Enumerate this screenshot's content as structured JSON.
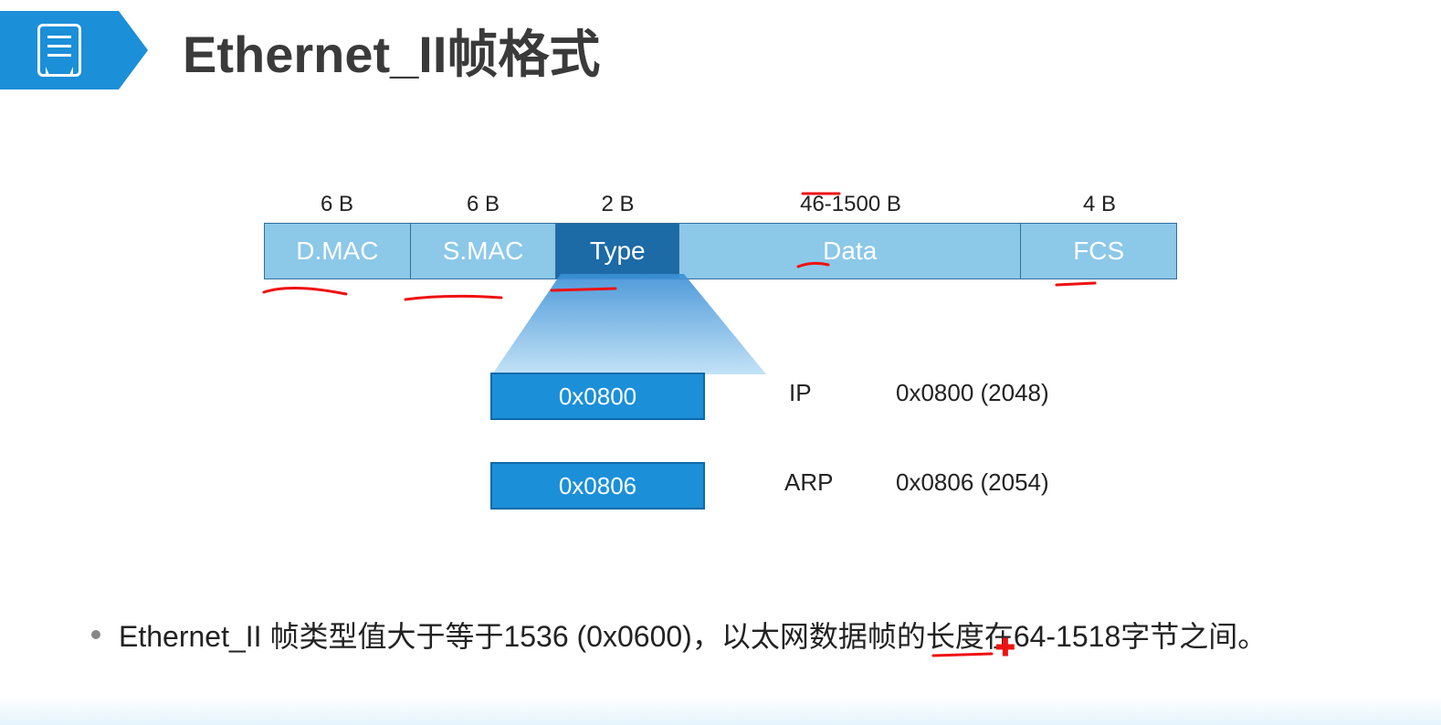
{
  "header": {
    "title": "Ethernet_II帧格式"
  },
  "frame": {
    "fields": [
      {
        "size": "6 B",
        "label": "D.MAC",
        "wclass": "w-dmac",
        "shade": "light"
      },
      {
        "size": "6 B",
        "label": "S.MAC",
        "wclass": "w-smac",
        "shade": "light"
      },
      {
        "size": "2 B",
        "label": "Type",
        "wclass": "w-type",
        "shade": "dark"
      },
      {
        "size": "46-1500 B",
        "label": "Data",
        "wclass": "w-data",
        "shade": "light"
      },
      {
        "size": "4 B",
        "label": "FCS",
        "wclass": "w-fcs",
        "shade": "light"
      }
    ]
  },
  "type_values": {
    "box1": "0x0800",
    "box2": "0x0806",
    "row1_proto": "IP",
    "row1_val": "0x0800 (2048)",
    "row2_proto": "ARP",
    "row2_val": "0x0806 (2054)"
  },
  "bullet": {
    "text": "Ethernet_II 帧类型值大于等于1536 (0x0600)，以太网数据帧的长度在64-1518字节之间。"
  }
}
